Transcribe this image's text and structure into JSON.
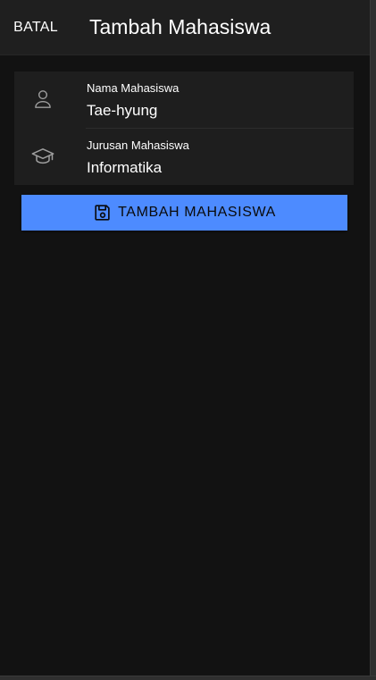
{
  "toolbar": {
    "cancel_label": "BATAL",
    "title": "Tambah Mahasiswa"
  },
  "form": {
    "fields": [
      {
        "label": "Nama Mahasiswa",
        "value": "Tae-hyung",
        "icon": "person-icon"
      },
      {
        "label": "Jurusan Mahasiswa",
        "value": "Informatika",
        "icon": "graduation-cap-icon"
      }
    ],
    "submit": {
      "label": "TAMBAH MAHASISWA",
      "icon": "save-icon"
    }
  },
  "colors": {
    "background": "#121212",
    "toolbar": "#1f1f1f",
    "card": "#1e1e1e",
    "accent": "#4d8bff",
    "icon": "#9e9e9e"
  }
}
